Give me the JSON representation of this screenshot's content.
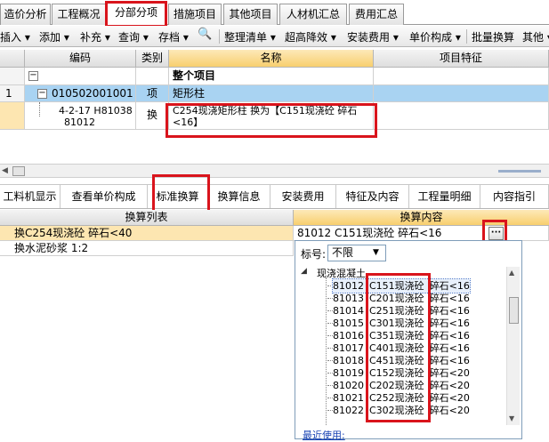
{
  "tabs": [
    "造价分析",
    "工程概况",
    "分部分项",
    "措施项目",
    "其他项目",
    "人材机汇总",
    "费用汇总"
  ],
  "toolbar": {
    "items": [
      "插入",
      "添加",
      "补充",
      "查询",
      "存档",
      "整理清单",
      "超高降效",
      "安装费用",
      "单价构成",
      "批量换算",
      "其他"
    ],
    "binoculars": "🔍"
  },
  "grid": {
    "headers": {
      "code": "编码",
      "type": "类别",
      "name": "名称",
      "feature": "项目特征"
    },
    "rows": [
      {
        "num": "",
        "code": "",
        "type": "",
        "name": "整个项目"
      },
      {
        "num": "1",
        "code": "010502001001",
        "type": "项",
        "name": "矩形柱"
      },
      {
        "num": "",
        "code_line1": "4-2-17 H81038",
        "code_line2": "81012",
        "type": "换",
        "name_line1": "C254现浇矩形柱  换为【C151现浇砼 碎石",
        "name_line2": "<16】"
      }
    ]
  },
  "bottom_tabs": [
    "工料机显示",
    "查看单价构成",
    "标准换算",
    "换算信息",
    "安装费用",
    "特征及内容",
    "工程量明细",
    "内容指引"
  ],
  "conversion": {
    "list_header": "换算列表",
    "content_header": "换算内容",
    "rows": [
      {
        "list": "换C254现浇砼 碎石<40",
        "content": "81012  C151现浇砼 碎石<16"
      },
      {
        "list": "换水泥砂浆 1:2",
        "content": ""
      }
    ],
    "more_button": "···"
  },
  "dropdown": {
    "label_text": "标号:",
    "select_value": "不限",
    "tree_root": "现浇混凝土",
    "items": [
      {
        "code": "81012",
        "name": "C151现浇砼",
        "spec": "碎石<16"
      },
      {
        "code": "81013",
        "name": "C201现浇砼",
        "spec": "碎石<16"
      },
      {
        "code": "81014",
        "name": "C251现浇砼",
        "spec": "碎石<16"
      },
      {
        "code": "81015",
        "name": "C301现浇砼",
        "spec": "碎石<16"
      },
      {
        "code": "81016",
        "name": "C351现浇砼",
        "spec": "碎石<16"
      },
      {
        "code": "81017",
        "name": "C401现浇砼",
        "spec": "碎石<16"
      },
      {
        "code": "81018",
        "name": "C451现浇砼",
        "spec": "碎石<16"
      },
      {
        "code": "81019",
        "name": "C152现浇砼",
        "spec": "碎石<20"
      },
      {
        "code": "81020",
        "name": "C202现浇砼",
        "spec": "碎石<20"
      },
      {
        "code": "81021",
        "name": "C252现浇砼",
        "spec": "碎石<20"
      },
      {
        "code": "81022",
        "name": "C302现浇砼",
        "spec": "碎石<20"
      }
    ],
    "recent_label": "最近使用:"
  },
  "colors": {
    "selected_row": "#a9d3f2",
    "orange_header": "#f8cf6e",
    "highlight": "#fde6b1",
    "red_marker": "#d9141c"
  }
}
